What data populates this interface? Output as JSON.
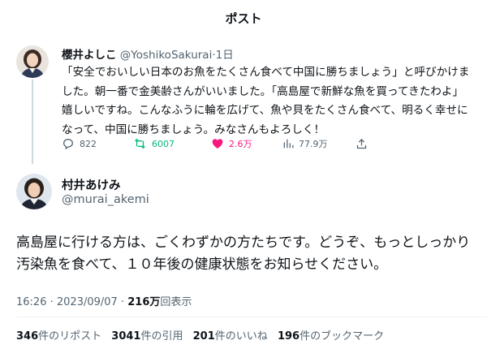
{
  "header": {
    "title": "ポスト"
  },
  "reply": {
    "name": "櫻井よしこ",
    "handle": "@YoshikoSakurai",
    "sep": "·",
    "time": "1日",
    "text": "「安全でおいしい日本のお魚をたくさん食べて中国に勝ちましょう」と呼びかけました。朝一番で金美齢さんがいいました。「高島屋で新鮮な魚を買ってきたわよ」嬉しいですね。こんなふうに輪を広げて、魚や貝をたくさん食べて、明るく幸せになって、中国に勝ちましょう。みなさんもよろしく！",
    "actions": {
      "replies": "822",
      "reposts": "6007",
      "likes": "2.6万",
      "views": "77.9万"
    }
  },
  "main": {
    "name": "村井あけみ",
    "handle": "@murai_akemi",
    "text": "高島屋に行ける方は、ごくわずかの方たちです。どうぞ、もっとしっかり汚染魚を食べて、１０年後の健康状態をお知らせください。",
    "time": "16:26",
    "date": "2023/09/07",
    "dot": "·",
    "views_count": "216万",
    "views_label": "回表示"
  },
  "stats": [
    {
      "count": "346",
      "label": "件のリポスト"
    },
    {
      "count": "3041",
      "label": "件の引用"
    },
    {
      "count": "201",
      "label": "件のいいね"
    },
    {
      "count": "196",
      "label": "件のブックマーク"
    }
  ],
  "colors": {
    "text": "#0f1419",
    "muted": "#536471",
    "repost": "#00ba7c",
    "like": "#f91880",
    "line": "#cfd9de"
  }
}
